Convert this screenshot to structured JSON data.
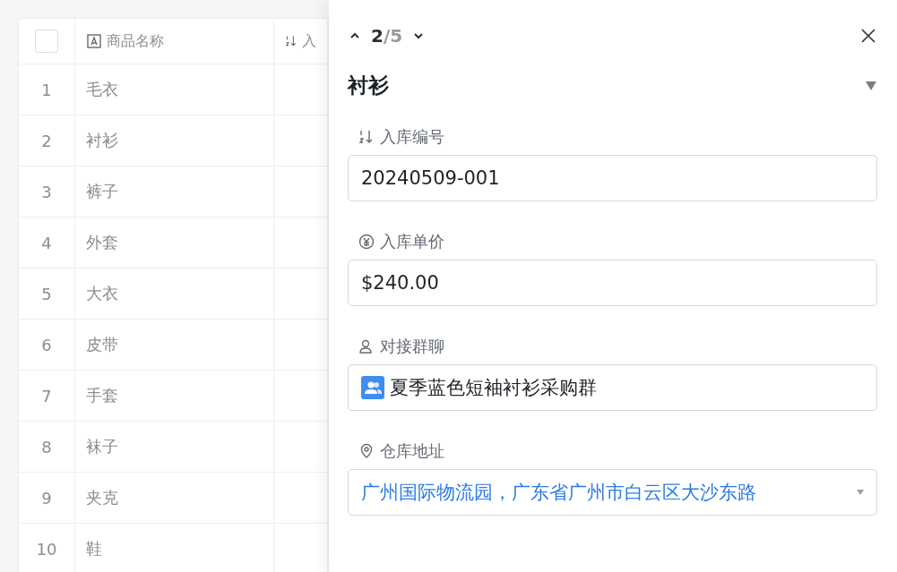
{
  "table": {
    "columns": [
      {
        "kind": "checkbox",
        "checked": false
      },
      {
        "kind": "text",
        "label": "商品名称"
      },
      {
        "kind": "number",
        "label": "入"
      }
    ],
    "rows": [
      {
        "index": "1",
        "name": "毛衣"
      },
      {
        "index": "2",
        "name": "衬衫"
      },
      {
        "index": "3",
        "name": "裤子"
      },
      {
        "index": "4",
        "name": "外套"
      },
      {
        "index": "5",
        "name": "大衣"
      },
      {
        "index": "6",
        "name": "皮带"
      },
      {
        "index": "7",
        "name": "手套"
      },
      {
        "index": "8",
        "name": "袜子"
      },
      {
        "index": "9",
        "name": "夹克"
      },
      {
        "index": "10",
        "name": "鞋"
      }
    ]
  },
  "panel": {
    "counter": {
      "current": "2",
      "total": "/5"
    },
    "title": "衬衫",
    "fields": [
      {
        "kind": "number",
        "label": "入库编号",
        "value": "20240509-001"
      },
      {
        "kind": "currency",
        "label": "入库单价",
        "value": "$240.00"
      },
      {
        "kind": "group",
        "label": "对接群聊",
        "value": "夏季蓝色短袖衬衫采购群"
      },
      {
        "kind": "location",
        "label": "仓库地址",
        "value": "广州国际物流园，广东省广州市白云区大沙东路"
      }
    ]
  }
}
